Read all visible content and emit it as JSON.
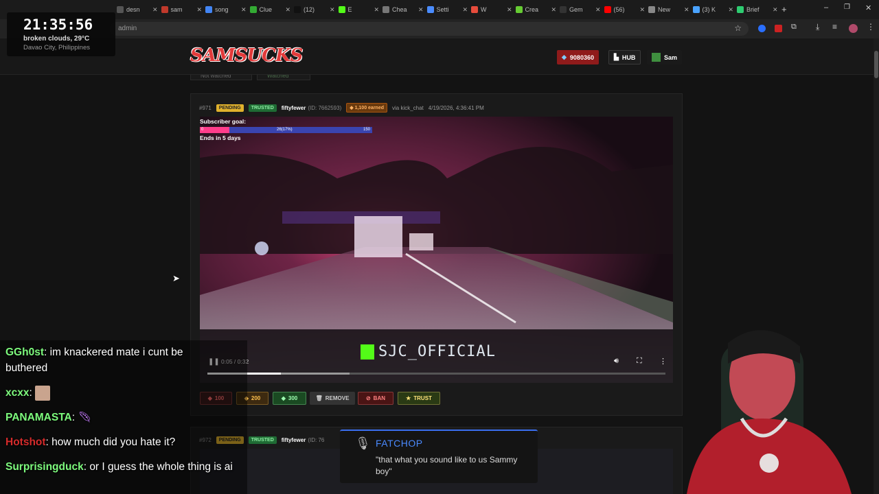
{
  "clock": {
    "time": "21:35:56",
    "weather": "broken clouds, 29°C",
    "location": "Davao City, Philippines"
  },
  "browser": {
    "tabs": [
      {
        "label": "desn",
        "color": "#555"
      },
      {
        "label": "sam",
        "color": "#c0392b"
      },
      {
        "label": "song",
        "color": "#4285f4"
      },
      {
        "label": "Clue",
        "color": "#3a3"
      },
      {
        "label": "(12)",
        "color": "#111"
      },
      {
        "label": "E",
        "color": "#53fc18"
      },
      {
        "label": "Chea",
        "color": "#777"
      },
      {
        "label": "Setti",
        "color": "#4a8cff"
      },
      {
        "label": "W",
        "color": "#e74c3c"
      },
      {
        "label": "Crea",
        "color": "#6c3"
      },
      {
        "label": "Gem",
        "color": "#333"
      },
      {
        "label": "(56)",
        "color": "#f00"
      },
      {
        "label": "New",
        "color": "#888"
      },
      {
        "label": "(3) K",
        "color": "#4aa3ff"
      },
      {
        "label": "Brief",
        "color": "#2ecc71"
      }
    ],
    "address_fragment": "admin"
  },
  "site": {
    "logo": "SAMSUCKS",
    "points_badge": "9080360",
    "hub_label": "HUB",
    "user_label": "Sam",
    "filter_not_watched": "Not watched",
    "filter_watched": "Watched"
  },
  "submission": {
    "id": "#971",
    "status": "PENDING",
    "trust": "TRUSTED",
    "user": "fiftyfewer",
    "user_id": "(ID: 7662593)",
    "earned": "1,100 earned",
    "via": "via kick_chat",
    "date": "4/19/2026, 4:36:41 PM",
    "overlay_goal_label": "Subscriber goal:",
    "overlay_goal_min": "0",
    "overlay_goal_progress": "26(17%)",
    "overlay_goal_max": "150",
    "overlay_goal_fraction": 0.17,
    "overlay_ends": "Ends in 5 days",
    "watermark": "SJC_OFFICIAL",
    "video_time": "0:05 / 0:32",
    "video_progress_fraction": 0.16,
    "video_buffer_fraction": 0.31,
    "actions": [
      {
        "label": "100",
        "color": "#ff6b6b",
        "bg": "#3a1a1a"
      },
      {
        "label": "200",
        "color": "#ffc14d",
        "bg": "#3d2a10"
      },
      {
        "label": "300",
        "color": "#9dffb0",
        "bg": "#1a4a22"
      },
      {
        "label": "REMOVE",
        "color": "#ccc",
        "bg": "#333"
      },
      {
        "label": "BAN",
        "color": "#ff8080",
        "bg": "#4a1414"
      },
      {
        "label": "TRUST",
        "color": "#ffe37a",
        "bg": "#2a3a14"
      }
    ]
  },
  "submission2": {
    "id": "#972",
    "status": "PENDING",
    "trust": "TRUSTED",
    "user": "fiftyfewer",
    "user_id_partial": "(ID: 76"
  },
  "tts": {
    "name": "FATCHOP",
    "message": "\"that what you sound like to us Sammy boy\""
  },
  "chat": [
    {
      "name": "GGh0st",
      "color": "#7dfa7d",
      "text": "im knackered mate i cunt be buthered"
    },
    {
      "name": "xcxx",
      "color": "#7dfa7d",
      "text": ""
    },
    {
      "name": "PANAMASTA",
      "color": "#7dfa7d",
      "text": ""
    },
    {
      "name": "Hotshot",
      "color": "#d62b2b",
      "text": "how much did you hate it?"
    },
    {
      "name": "Surprisingduck",
      "color": "#7dfa7d",
      "text": "or I guess the whole thing is ai"
    }
  ]
}
